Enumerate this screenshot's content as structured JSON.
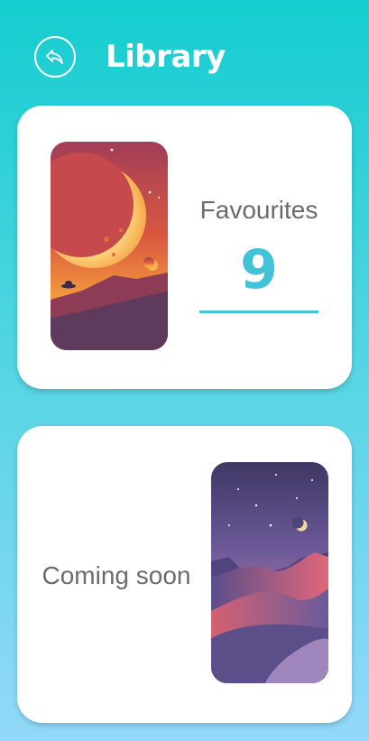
{
  "header": {
    "title": "Library",
    "back_icon": "reply-arrow-icon"
  },
  "favourites_card": {
    "label": "Favourites",
    "count": "9",
    "image": "moon-planet-landscape-illustration",
    "accent": "#40c3d6"
  },
  "coming_soon_card": {
    "label": "Coming soon",
    "image": "night-desert-dunes-illustration"
  },
  "colors": {
    "background_top": "#14cdd0",
    "background_bottom": "#93d8f9",
    "card": "#ffffff",
    "text": "#6b6b6b"
  }
}
